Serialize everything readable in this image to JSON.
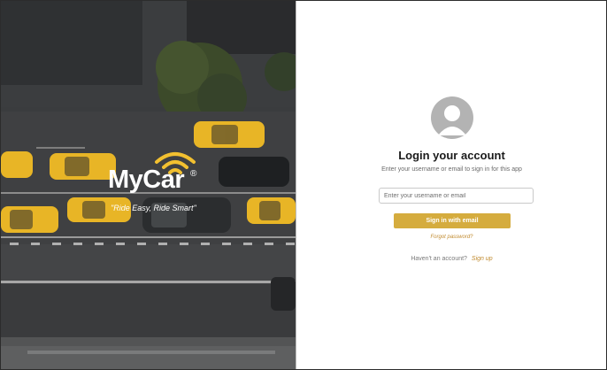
{
  "hero": {
    "brand_name": "MyCar",
    "brand_reg": "®",
    "tagline": "\"Ride Easy, Ride Smart\"",
    "logo_icon": "wifi-signal-icon",
    "accent_color": "#f2c030",
    "taxi_color": "#e8b526"
  },
  "login": {
    "avatar_icon": "user-avatar-icon",
    "title": "Login your account",
    "subtitle": "Enter your username or email to sign in for this app",
    "username_placeholder": "Enter your username or email",
    "username_value": "",
    "signin_label": "Sign in with email",
    "forgot_label": "Forgot password?",
    "no_account_text": "Haven't an account?",
    "signup_label": "Sign up",
    "button_color": "#d5ac3e",
    "link_color": "#c08a2e"
  }
}
